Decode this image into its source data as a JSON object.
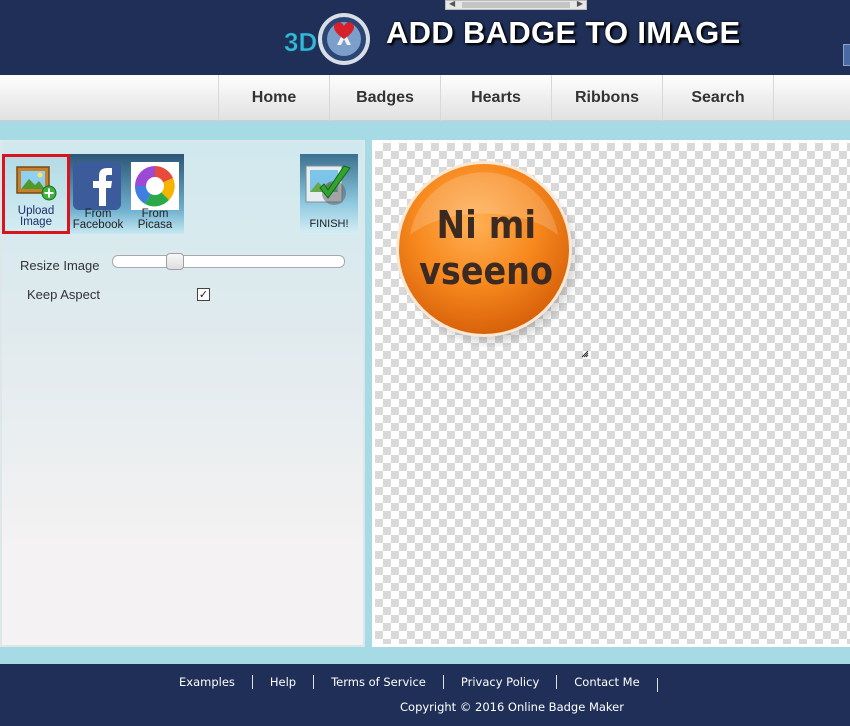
{
  "header": {
    "site_title": "ADD BADGE TO IMAGE",
    "logo_text": "3D"
  },
  "nav": {
    "items": [
      {
        "label": "Home"
      },
      {
        "label": "Badges"
      },
      {
        "label": "Hearts"
      },
      {
        "label": "Ribbons"
      },
      {
        "label": "Search"
      }
    ]
  },
  "tools": {
    "upload": {
      "label_line1": "Upload",
      "label_line2": "Image",
      "icon": "upload-image-icon"
    },
    "facebook": {
      "label_line1": "From",
      "label_line2": "Facebook",
      "icon": "facebook-icon"
    },
    "picasa": {
      "label_line1": "From",
      "label_line2": "Picasa",
      "icon": "picasa-icon"
    },
    "finish": {
      "label": "FINISH!",
      "icon": "finish-checkmark-icon"
    }
  },
  "controls": {
    "resize_label": "Resize Image",
    "resize_level": 0.25,
    "keep_aspect_label": "Keep Aspect",
    "keep_aspect_checked": true
  },
  "canvas": {
    "badge_line1": "Ni mi",
    "badge_line2": "vseeno",
    "badge_color": "#f7891e"
  },
  "footer": {
    "links": [
      {
        "label": "Examples"
      },
      {
        "label": "Help"
      },
      {
        "label": "Terms of Service"
      },
      {
        "label": "Privacy Policy"
      },
      {
        "label": "Contact Me"
      }
    ],
    "copyright": "Copyright © 2016 Online Badge Maker"
  },
  "colors": {
    "header_bg": "#1f2f57",
    "page_bg": "#a6dbe5",
    "upload_highlight": "#d8141c"
  }
}
